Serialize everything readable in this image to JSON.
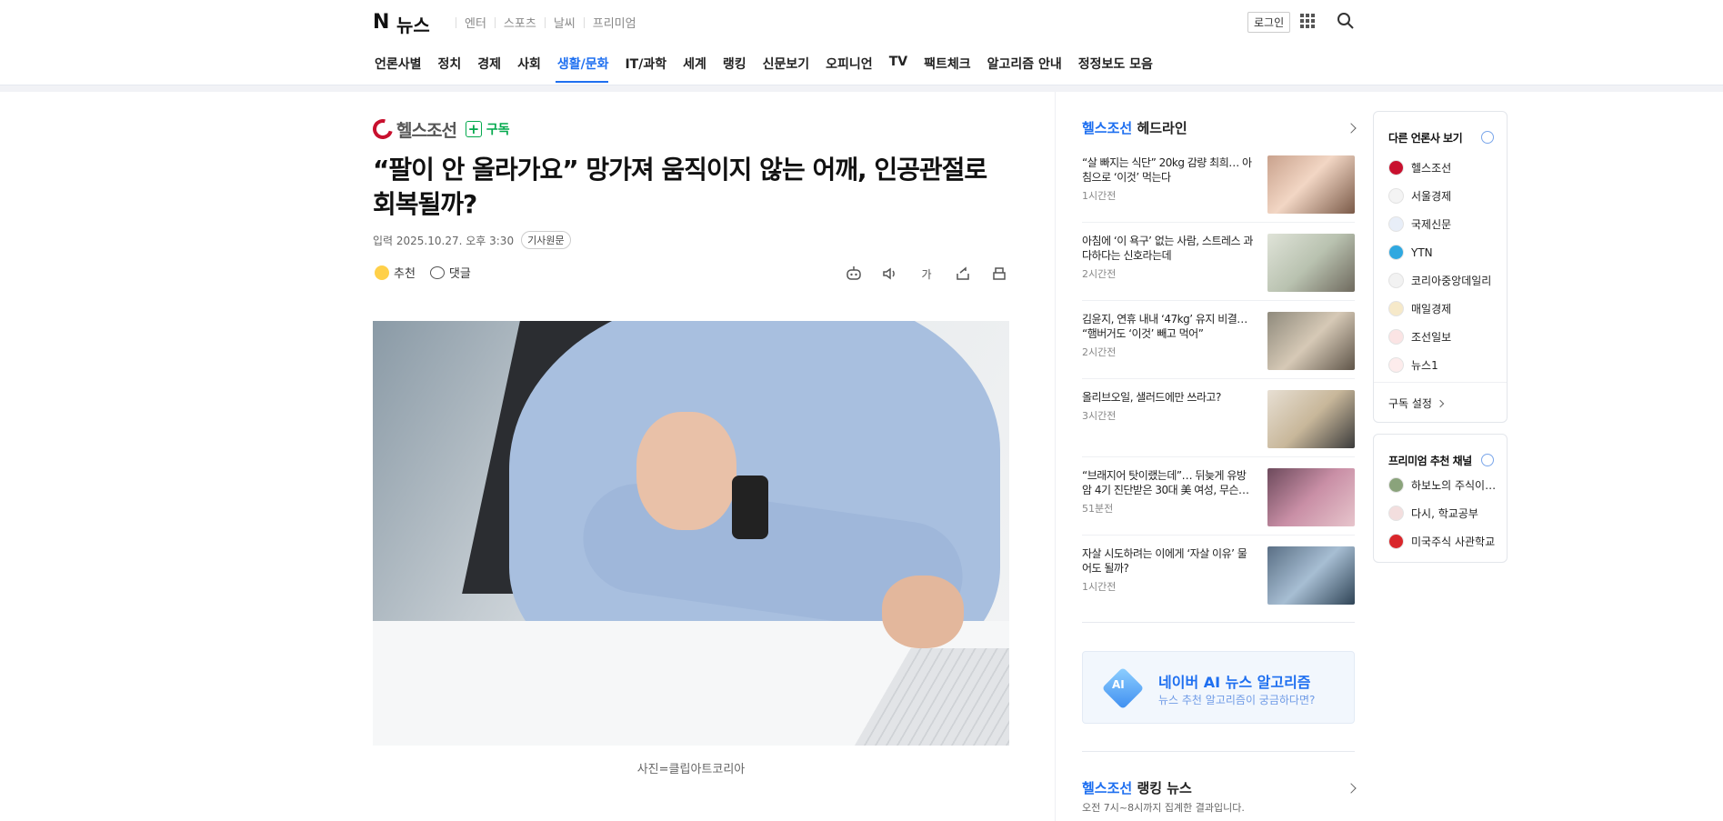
{
  "header": {
    "logo": "N",
    "service": "뉴스",
    "links": [
      "엔터",
      "스포츠",
      "날씨",
      "프리미엄"
    ],
    "login_label": "로그인",
    "menu": [
      "언론사별",
      "정치",
      "경제",
      "사회",
      "생활/문화",
      "IT/과학",
      "세계",
      "랭킹",
      "신문보기",
      "오피니언",
      "TV",
      "팩트체크",
      "알고리즘 안내",
      "정정보도 모음"
    ],
    "active_menu": "생활/문화",
    "accent_color": "#1e6ff0"
  },
  "article": {
    "press": "헬스조선",
    "subscribe_label": "구독",
    "title": "“팔이 안 올라가요” 망가져 움직이지 않는 어깨, 인공관절로 회복될까?",
    "date_label": "입력 2025.10.27. 오후 3:30",
    "original_label": "기사원문",
    "recommend_label": "추천",
    "comment_label": "댓글",
    "font_size_label": "가",
    "caption": "사진=클립아트코리아"
  },
  "headline": {
    "press": "헬스조선",
    "suffix": "헤드라인",
    "items": [
      {
        "title": "“살 빠지는 식단” 20kg 감량 최희… 아침으로 ‘이것’ 먹는다",
        "time": "1시간전"
      },
      {
        "title": "아침에 ‘이 욕구’ 없는 사람, 스트레스 과다하다는 신호라는데",
        "time": "2시간전"
      },
      {
        "title": "김윤지, 연휴 내내 ‘47kg’ 유지 비결… “햄버거도 ‘이것’ 빼고 먹어”",
        "time": "2시간전"
      },
      {
        "title": "올리브오일, 샐러드에만 쓰라고?",
        "time": "3시간전"
      },
      {
        "title": "“브래지어 탓이랬는데”… 뒤늦게 유방암 4기 진단받은 30대 美 여성, 무슨…",
        "time": "51분전"
      },
      {
        "title": "자살 시도하려는 이에게 ‘자살 이유’ 물어도 될까?",
        "time": "1시간전"
      }
    ]
  },
  "ai_banner": {
    "cube_label": "AI",
    "title": "네이버 AI 뉴스 알고리즘",
    "subtitle": "뉴스 추천 알고리즘이 궁금하다면?"
  },
  "ranking": {
    "press": "헬스조선",
    "suffix": "랭킹 뉴스",
    "subtitle": "오전 7시~8시까지 집계한 결과입니다."
  },
  "aside": {
    "other_press_title": "다른 언론사 보기",
    "press_list": [
      "헬스조선",
      "서울경제",
      "국제신문",
      "YTN",
      "코리아중앙데일리",
      "매일경제",
      "조선일보",
      "뉴스1"
    ],
    "subscribe_setting": "구독 설정",
    "premium_title": "프리미엄 추천 채널",
    "premium_list": [
      "하보노의 주식이…",
      "다시, 학교공부",
      "미국주식 사관학교"
    ]
  }
}
